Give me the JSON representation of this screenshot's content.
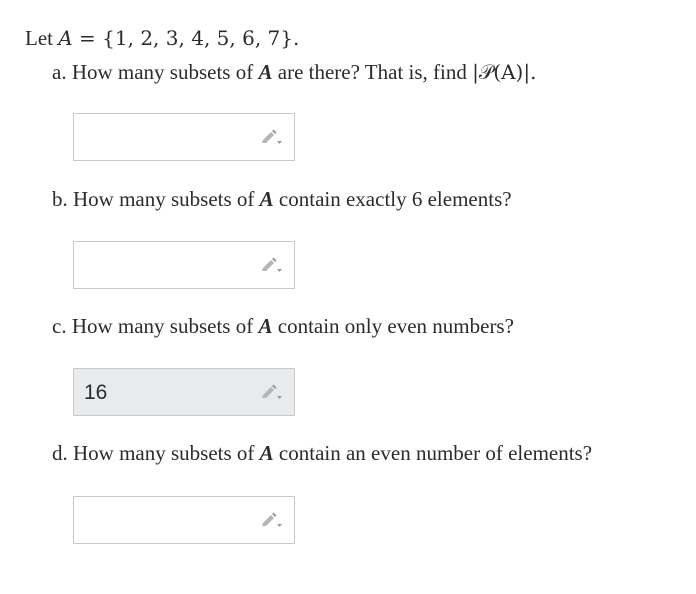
{
  "intro": {
    "prefix": "Let",
    "set_name": "A",
    "equals": "=",
    "set_contents": "{1, 2, 3, 4, 5, 6, 7}."
  },
  "questions": [
    {
      "prefix": "a. How many subsets of",
      "var": "A",
      "suffix_before_math": "are there? That is, find",
      "math": "|𝒫(A)|.",
      "answer": "",
      "icon": "pencil-dropdown-icon"
    },
    {
      "prefix": "b. How many subsets of",
      "var": "A",
      "suffix": "contain exactly 6 elements?",
      "answer": "",
      "icon": "pencil-dropdown-icon"
    },
    {
      "prefix": "c. How many subsets of",
      "var": "A",
      "suffix": "contain only even numbers?",
      "answer": "16",
      "icon": "pencil-dropdown-icon"
    },
    {
      "prefix": "d. How many subsets of",
      "var": "A",
      "suffix": "contain an even number of elements?",
      "answer": "",
      "icon": "pencil-dropdown-icon"
    }
  ],
  "colors": {
    "text": "#2b2b2b",
    "box_border": "#c9c9c9",
    "filled_box_bg": "#e8eaed",
    "icon": "#9a9a9a"
  }
}
